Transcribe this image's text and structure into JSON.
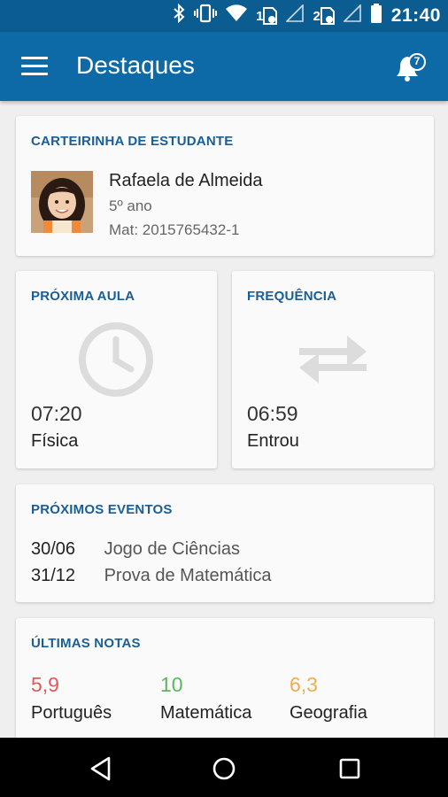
{
  "status_bar": {
    "time": "21:40",
    "sim1_label": "1",
    "sim2_label": "2",
    "icons": [
      "bluetooth-icon",
      "vibrate-icon",
      "wifi-icon",
      "sim1-icon",
      "signal-icon",
      "sim2-icon",
      "signal-icon",
      "battery-icon"
    ]
  },
  "app_bar": {
    "title": "Destaques",
    "notification_count": "7"
  },
  "student_card": {
    "title": "CARTEIRINHA DE ESTUDANTE",
    "name": "Rafaela de Almeida",
    "grade": "5º ano",
    "registration": "Mat: 2015765432-1"
  },
  "next_class": {
    "title": "PRÓXIMA AULA",
    "time": "07:20",
    "subject": "Física",
    "icon": "clock-icon"
  },
  "attendance": {
    "title": "FREQUÊNCIA",
    "time": "06:59",
    "status": "Entrou",
    "icon": "swap-arrows-icon"
  },
  "events": {
    "title": "PRÓXIMOS EVENTOS",
    "items": [
      {
        "date": "30/06",
        "name": "Jogo de Ciências"
      },
      {
        "date": "31/12",
        "name": "Prova de Matemática"
      }
    ]
  },
  "grades": {
    "title": "ÚLTIMAS NOTAS",
    "items": [
      {
        "value": "5,9",
        "subject": "Português",
        "color": "#e05a5a"
      },
      {
        "value": "10",
        "subject": "Matemática",
        "color": "#5cb85c"
      },
      {
        "value": "6,3",
        "subject": "Geografia",
        "color": "#f0ad4e"
      }
    ]
  },
  "nav_bar": {
    "buttons": [
      "back-icon",
      "home-icon",
      "recents-icon"
    ]
  }
}
